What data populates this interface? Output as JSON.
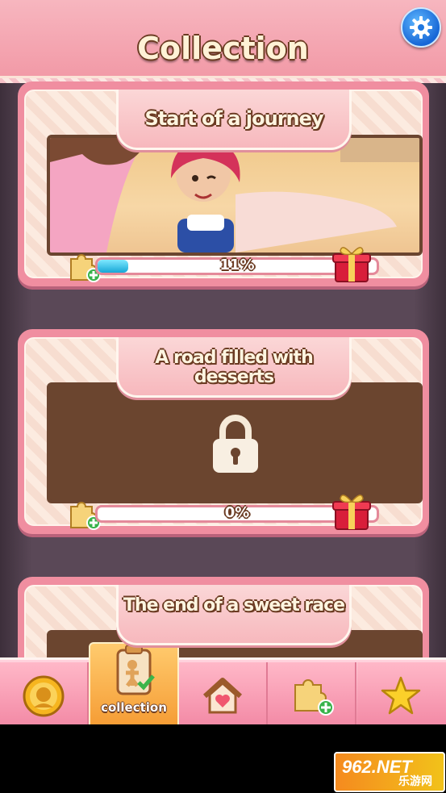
{
  "header": {
    "title": "Collection",
    "settings_icon": "gear-icon"
  },
  "cards": [
    {
      "title": "Start of a journey",
      "progress_label": "11%",
      "progress": 0.11,
      "locked": false
    },
    {
      "title": "A road filled with desserts",
      "progress_label": "0%",
      "progress": 0.0,
      "locked": true
    },
    {
      "title": "The end of a sweet race",
      "locked": true
    }
  ],
  "nav": {
    "items": [
      {
        "icon": "coin-face-icon",
        "label": ""
      },
      {
        "icon": "collection-icon",
        "label": "collection",
        "active": true
      },
      {
        "icon": "home-icon",
        "label": ""
      },
      {
        "icon": "puzzle-plus-icon",
        "label": ""
      },
      {
        "icon": "star-icon",
        "label": ""
      }
    ]
  },
  "watermark": {
    "brand": "962.NET",
    "subtitle": "乐游网"
  },
  "colors": {
    "header": "#f29aa7",
    "card": "#f08ea0",
    "progress_fill": "#17a7d6",
    "nav_active": "#f59b33"
  }
}
